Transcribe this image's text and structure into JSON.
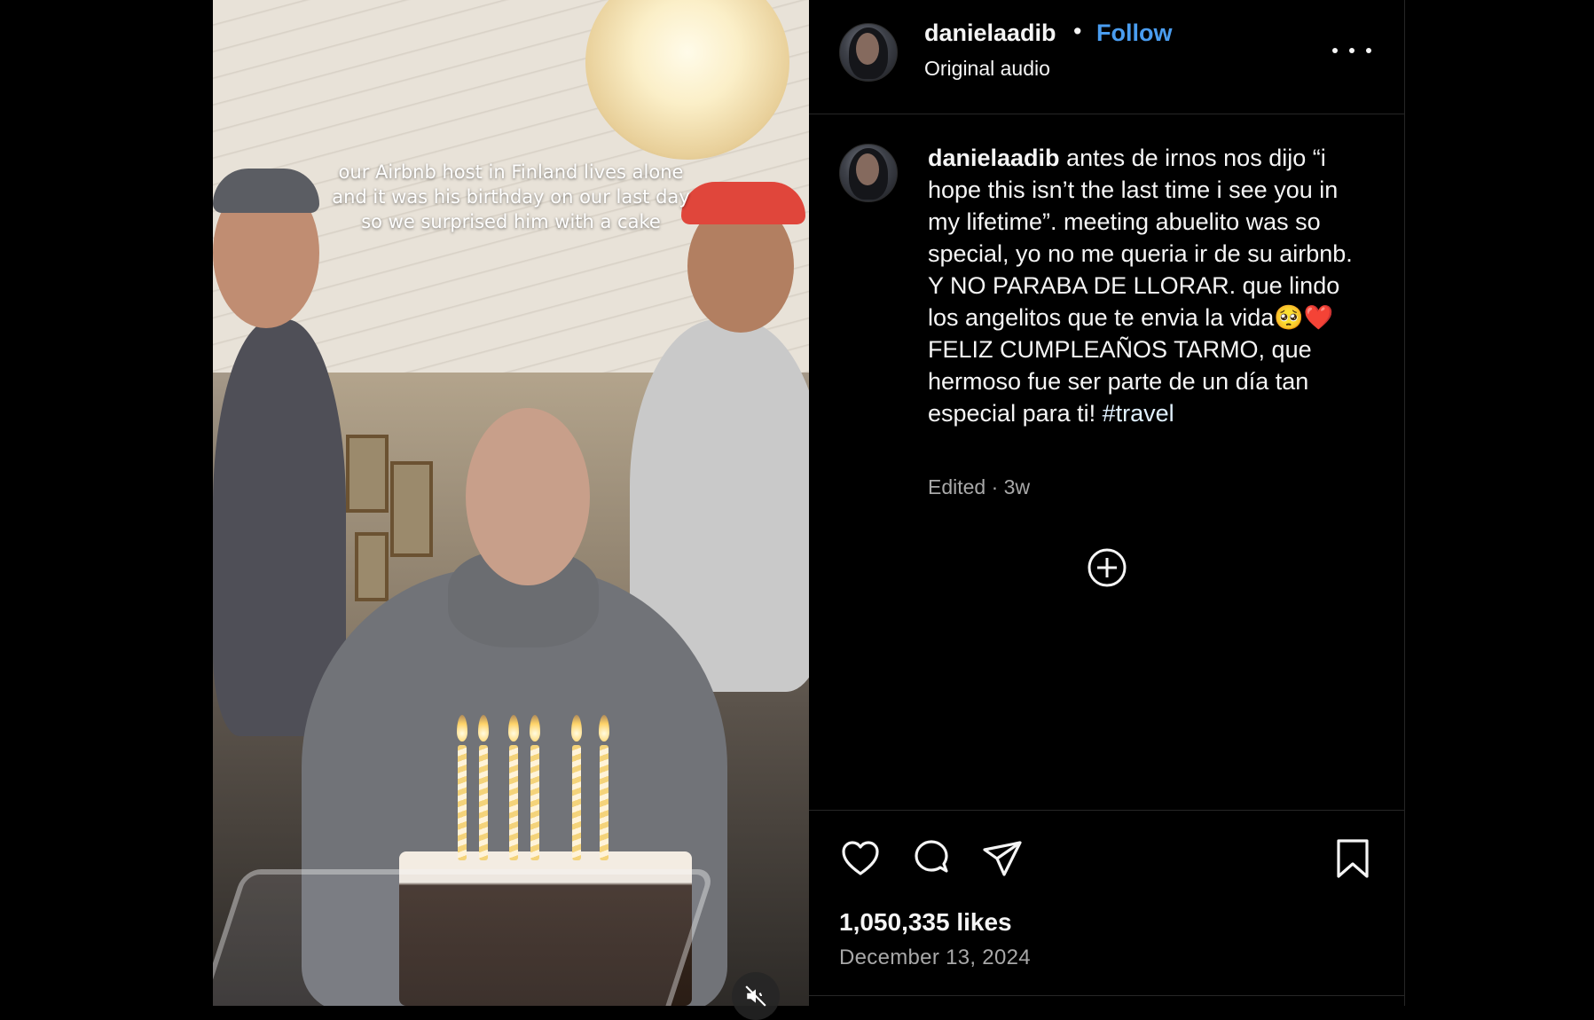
{
  "video": {
    "overlay_text": "our Airbnb host in Finland lives alone\nand it was his birthday on our last day\nso we surprised him with a cake",
    "muted": true
  },
  "header": {
    "username": "danielaadib",
    "separator": "•",
    "follow_label": "Follow",
    "audio_label": "Original audio"
  },
  "caption": {
    "username": "danielaadib",
    "text_before_emoji": "antes de irnos nos dijo “i hope this isn’t the last time i see you in my lifetime”. meeting abuelito was so special, yo no me queria ir de su airbnb. Y NO PARABA DE LLORAR. que lindo los angelitos que te envia la vida",
    "emoji": "🥺❤️",
    "text_after_emoji": " FELIZ CUMPLEAÑOS TARMO, que hermoso fue ser parte de un día tan especial para ti! ",
    "hashtag": "#travel",
    "meta": "Edited · 3w"
  },
  "actions": {
    "icons": [
      "heart-icon",
      "comment-icon",
      "share-icon",
      "bookmark-icon"
    ],
    "likes": "1,050,335 likes",
    "date": "December 13, 2024"
  },
  "colors": {
    "background": "#000000",
    "follow": "#4a9df0",
    "divider": "#262626",
    "secondary_text": "#a8a8a8"
  }
}
